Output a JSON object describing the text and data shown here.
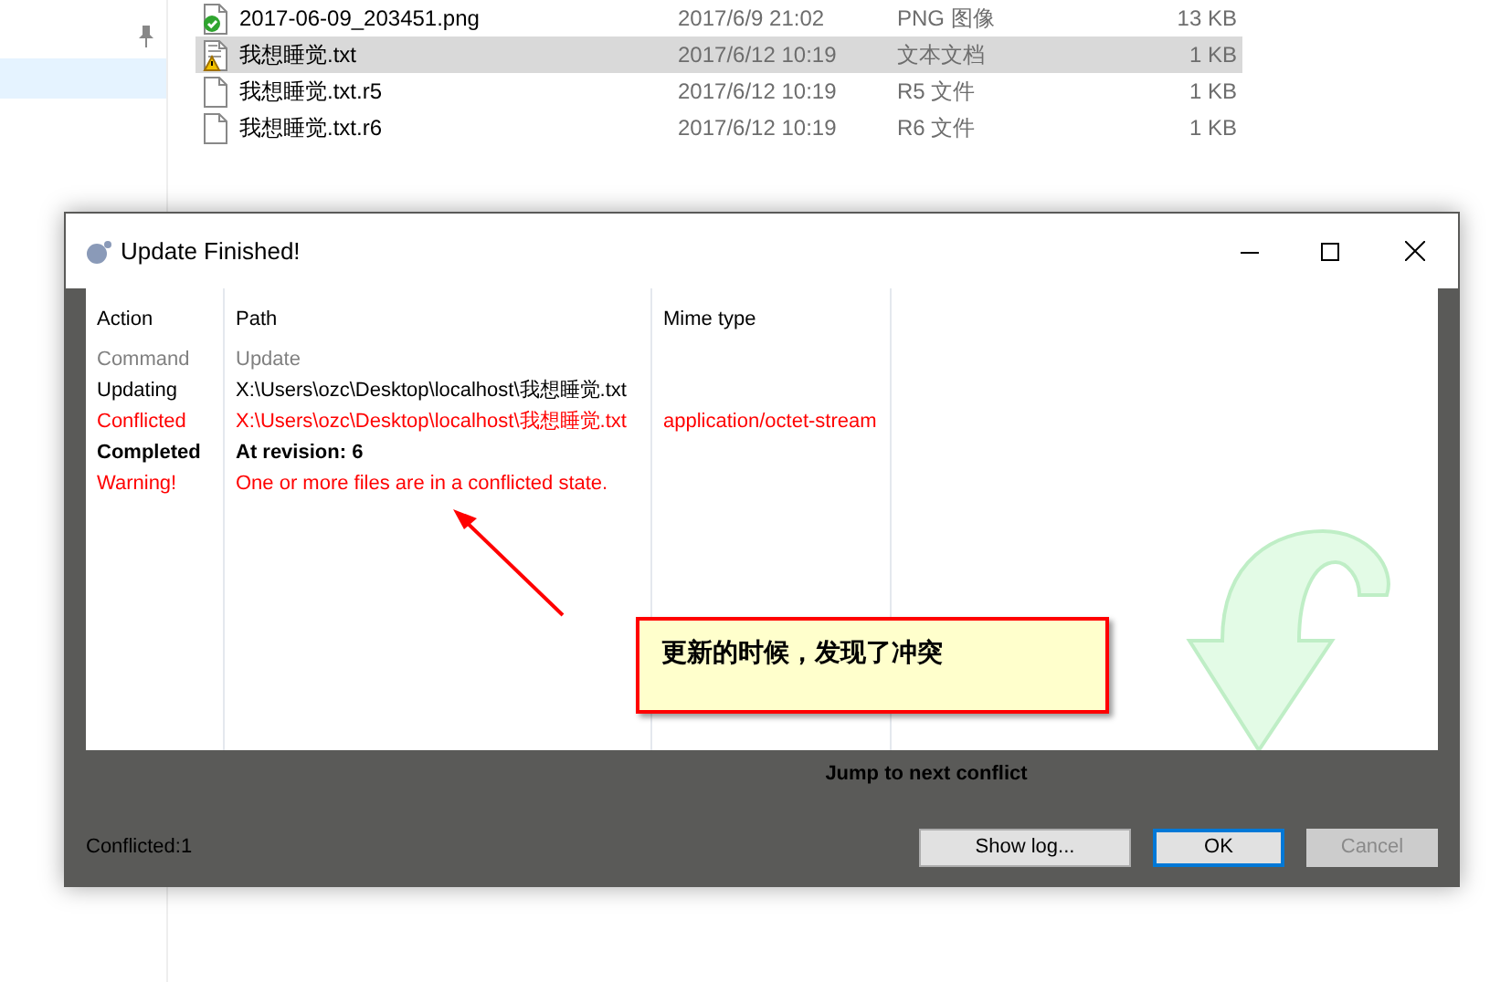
{
  "explorer": {
    "sidebar": [
      {
        "selected": true
      }
    ],
    "files": [
      {
        "kind": "image",
        "name": "2017-06-09_203451.png",
        "date": "2017/6/9 21:02",
        "type": "PNG 图像",
        "size": "13 KB",
        "selected": false
      },
      {
        "kind": "conflict",
        "name": "我想睡觉.txt",
        "date": "2017/6/12 10:19",
        "type": "文本文档",
        "size": "1 KB",
        "selected": true
      },
      {
        "kind": "file",
        "name": "我想睡觉.txt.r5",
        "date": "2017/6/12 10:19",
        "type": "R5 文件",
        "size": "1 KB",
        "selected": false
      },
      {
        "kind": "file",
        "name": "我想睡觉.txt.r6",
        "date": "2017/6/12 10:19",
        "type": "R6 文件",
        "size": "1 KB",
        "selected": false
      }
    ]
  },
  "dialog": {
    "title": "Update Finished!",
    "columns": [
      "Action",
      "Path",
      "Mime type"
    ],
    "rows": [
      {
        "kind": "command",
        "action": "Command",
        "path": "Update"
      },
      {
        "kind": "normal",
        "action": "Updating",
        "path": "X:\\Users\\ozc\\Desktop\\localhost\\我想睡觉.txt"
      },
      {
        "kind": "conflict",
        "action": "Conflicted",
        "path": "X:\\Users\\ozc\\Desktop\\localhost\\我想睡觉.txt",
        "mime": "application/octet-stream"
      },
      {
        "kind": "completed",
        "action": "Completed",
        "path": "At revision: 6"
      },
      {
        "kind": "warning",
        "action": "Warning!",
        "path": "One or more files are in a conflicted state."
      }
    ],
    "callout": "更新的时候，发现了冲突",
    "jump_link": "Jump to next conflict",
    "status": "Conflicted:1",
    "buttons": [
      {
        "label": "Show log...",
        "default": false,
        "disabled": false
      },
      {
        "label": "OK",
        "default": true,
        "disabled": false
      },
      {
        "label": "Cancel",
        "default": false,
        "disabled": true
      }
    ]
  }
}
